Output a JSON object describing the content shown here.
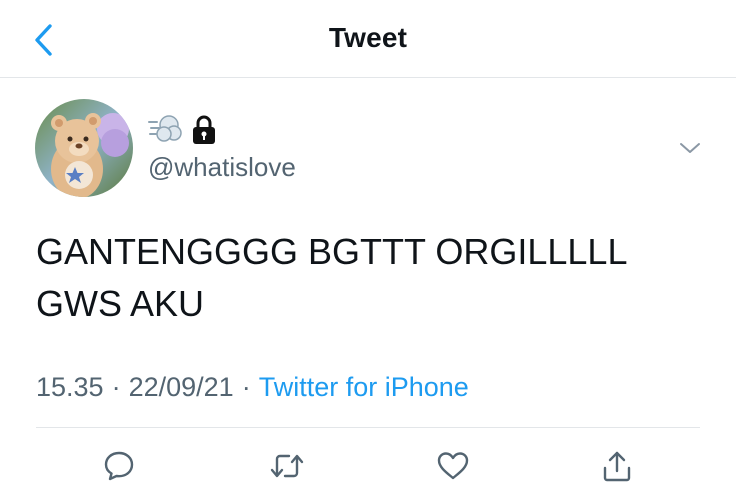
{
  "header": {
    "title": "Tweet",
    "back_icon": "chevron-left-icon"
  },
  "author": {
    "emoji_1": "dash-emoji",
    "emoji_2": "lock-icon",
    "handle": "@whatislove"
  },
  "tweet": {
    "text": "GANTENGGGG BGTTT ORGILLLLL\nGWS AKU"
  },
  "meta": {
    "time": "15.35",
    "separator": "·",
    "date": "22/09/21",
    "source": "Twitter for iPhone"
  },
  "actions": [
    "reply-icon",
    "retweet-icon",
    "like-icon",
    "share-icon"
  ],
  "colors": {
    "accent": "#1d9bf0",
    "secondary_text": "#536471",
    "divider": "#e3e6e9"
  }
}
